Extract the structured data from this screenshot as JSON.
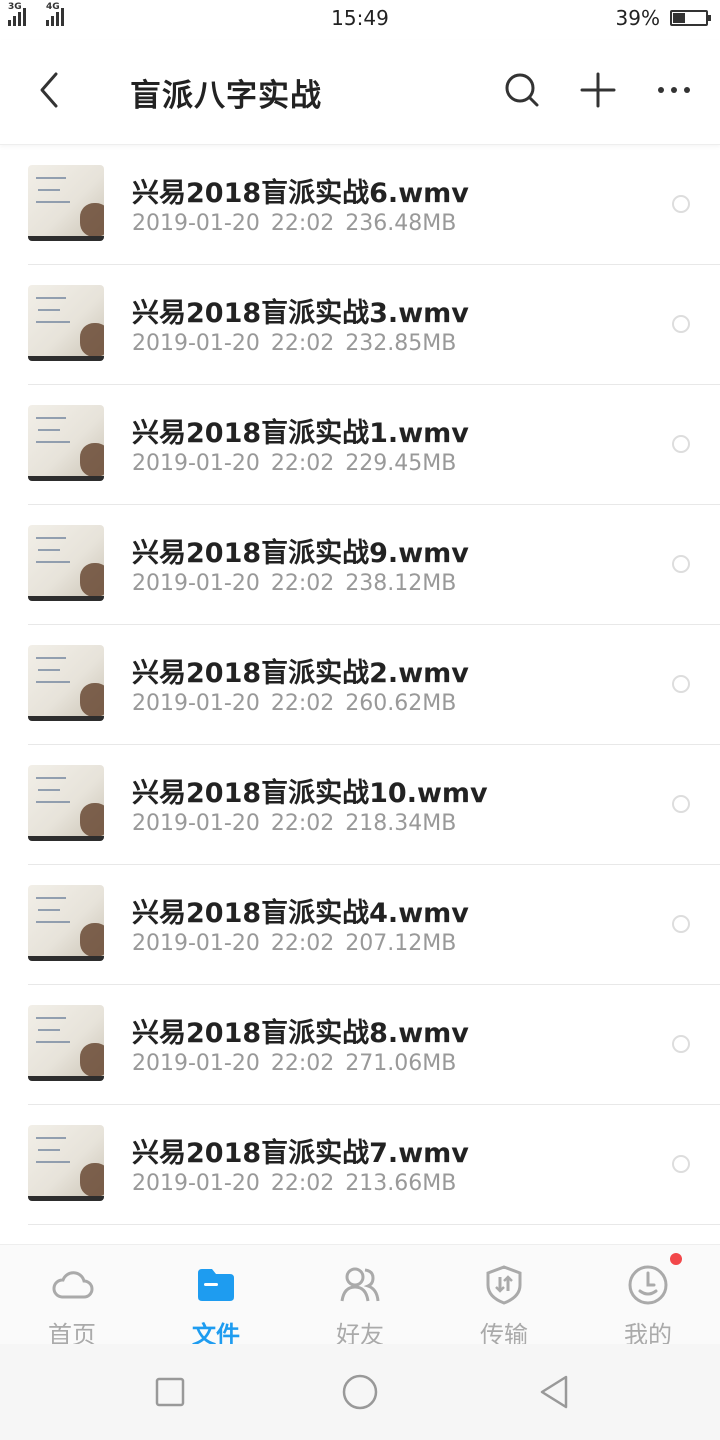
{
  "status_bar": {
    "network_1": "3G",
    "network_2": "4G",
    "time": "15:49",
    "battery_percent": "39%",
    "battery_level": 0.39
  },
  "header": {
    "title": "盲派八字实战"
  },
  "files": [
    {
      "name": "兴易2018盲派实战6.wmv",
      "date": "2019-01-20",
      "time": "22:02",
      "size": "236.48MB"
    },
    {
      "name": "兴易2018盲派实战3.wmv",
      "date": "2019-01-20",
      "time": "22:02",
      "size": "232.85MB"
    },
    {
      "name": "兴易2018盲派实战1.wmv",
      "date": "2019-01-20",
      "time": "22:02",
      "size": "229.45MB"
    },
    {
      "name": "兴易2018盲派实战9.wmv",
      "date": "2019-01-20",
      "time": "22:02",
      "size": "238.12MB"
    },
    {
      "name": "兴易2018盲派实战2.wmv",
      "date": "2019-01-20",
      "time": "22:02",
      "size": "260.62MB"
    },
    {
      "name": "兴易2018盲派实战10.wmv",
      "date": "2019-01-20",
      "time": "22:02",
      "size": "218.34MB"
    },
    {
      "name": "兴易2018盲派实战4.wmv",
      "date": "2019-01-20",
      "time": "22:02",
      "size": "207.12MB"
    },
    {
      "name": "兴易2018盲派实战8.wmv",
      "date": "2019-01-20",
      "time": "22:02",
      "size": "271.06MB"
    },
    {
      "name": "兴易2018盲派实战7.wmv",
      "date": "2019-01-20",
      "time": "22:02",
      "size": "213.66MB"
    }
  ],
  "tabs": [
    {
      "label": "首页",
      "icon": "cloud-icon",
      "active": false
    },
    {
      "label": "文件",
      "icon": "folder-icon",
      "active": true
    },
    {
      "label": "好友",
      "icon": "friends-icon",
      "active": false
    },
    {
      "label": "传输",
      "icon": "transfer-icon",
      "active": false
    },
    {
      "label": "我的",
      "icon": "profile-icon",
      "active": false,
      "badge": true
    }
  ],
  "colors": {
    "accent": "#1e9cf0",
    "badge": "#f2474a",
    "inactive_tab": "#aaaaaa",
    "meta_text": "#999999"
  }
}
